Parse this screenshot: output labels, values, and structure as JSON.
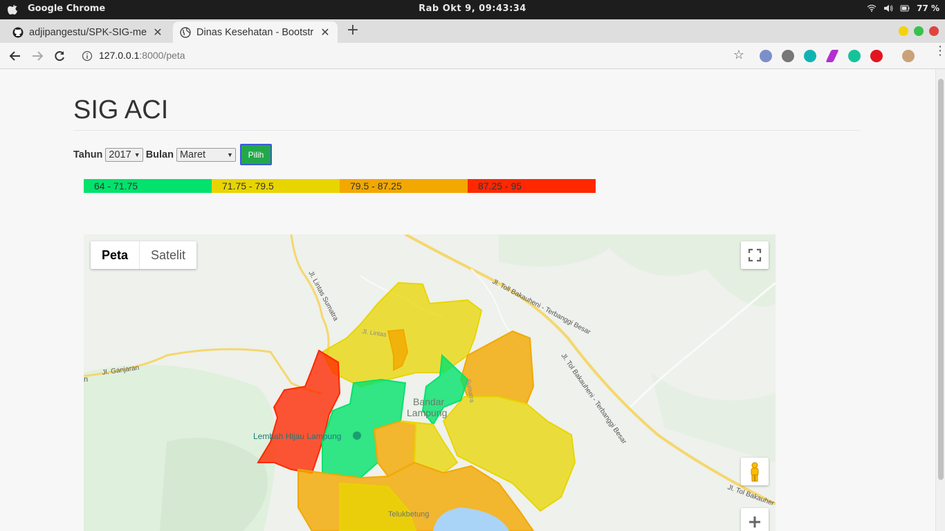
{
  "os": {
    "app_name": "Google Chrome",
    "clock": "Rab Okt  9, 09:43:34",
    "battery": "77 %"
  },
  "browser": {
    "tabs": [
      {
        "title": "adjipangestu/SPK-SIG-me",
        "active": false
      },
      {
        "title": "Dinas Kesehatan - Bootstr",
        "active": true
      }
    ],
    "url_host": "127.0.0.1",
    "url_path": ":8000/peta"
  },
  "page": {
    "title": "SIG ACI",
    "filters": {
      "year_label": "Tahun",
      "year_value": "2017",
      "month_label": "Bulan",
      "month_value": "Maret",
      "submit_label": "Pilih"
    },
    "legend": [
      {
        "range": "64 - 71.75",
        "color": "#03e26c"
      },
      {
        "range": "71.75 - 79.5",
        "color": "#e8d500"
      },
      {
        "range": "79.5 - 87.25",
        "color": "#f2a800"
      },
      {
        "range": "87.25 - 95",
        "color": "#ff2800"
      }
    ]
  },
  "map": {
    "type_options": {
      "map": "Peta",
      "satellite": "Satelit"
    },
    "selected_type": "Peta",
    "labels": {
      "city": "Bandar Lampung",
      "park": "Lembah Hijau Lampung",
      "district": "Telukbetung",
      "road_ganjaran": "Jl. Ganjaran",
      "road_lintas": "Jl. Lintas Sumatra",
      "road_toll": "Jl. Toll Bakauheni - Terbanggi Besar",
      "road_toll_2": "Jl. Tol Bakauheni - Terbanggi Besar",
      "road_toll_3": "Jl. Tol Bakauher",
      "edge_text": "n",
      "road_lintas_short": "Jl. Lintas",
      "road_sumatra": "Sumatra"
    }
  }
}
